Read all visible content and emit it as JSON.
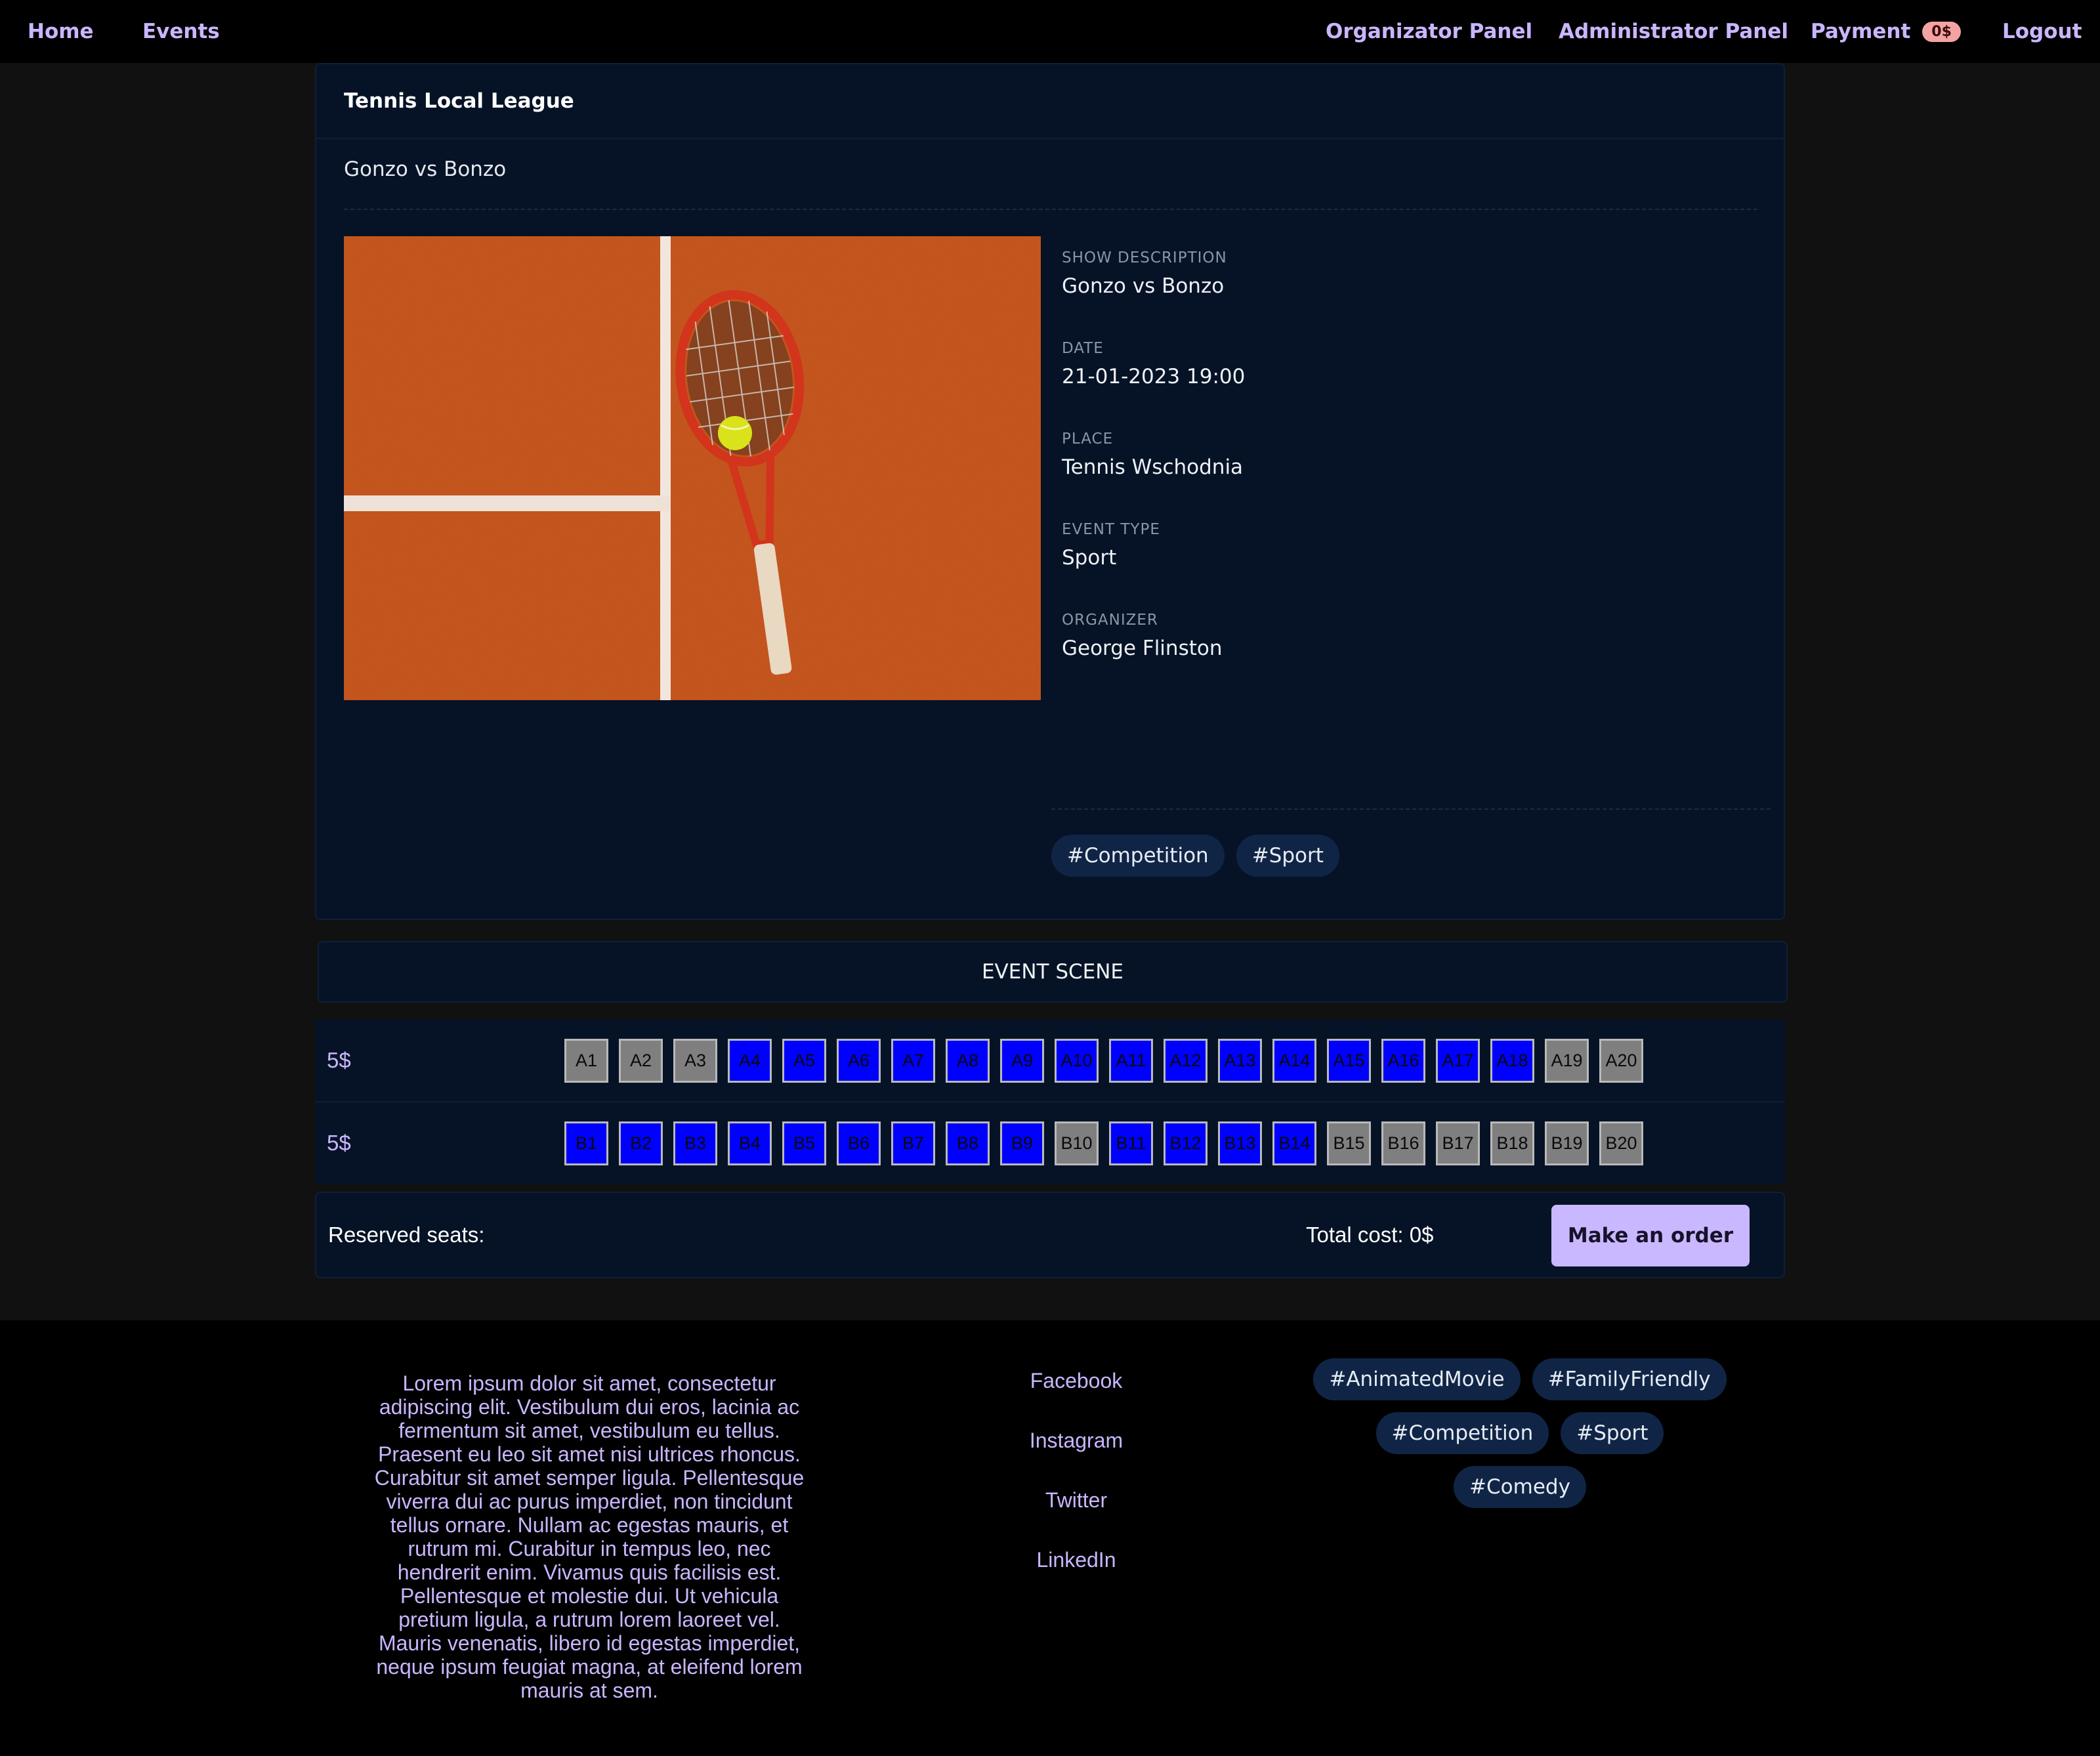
{
  "nav": {
    "home": "Home",
    "events": "Events",
    "organizer": "Organizator Panel",
    "admin": "Administrator Panel",
    "payment": "Payment",
    "payment_badge": "0$",
    "logout": "Logout"
  },
  "event": {
    "league": "Tennis Local League",
    "subtitle": "Gonzo vs Bonzo",
    "details": [
      {
        "label": "SHOW DESCRIPTION",
        "value": "Gonzo vs Bonzo"
      },
      {
        "label": "DATE",
        "value": "21-01-2023 19:00"
      },
      {
        "label": "PLACE",
        "value": "Tennis Wschodnia"
      },
      {
        "label": "EVENT TYPE",
        "value": "Sport"
      },
      {
        "label": "ORGANIZER",
        "value": "George Flinston"
      }
    ],
    "tags": [
      "#Competition",
      "#Sport"
    ]
  },
  "scene": {
    "title": "EVENT SCENE",
    "rows": [
      {
        "price": "5$",
        "seats": [
          {
            "label": "A1",
            "status": "free"
          },
          {
            "label": "A2",
            "status": "free"
          },
          {
            "label": "A3",
            "status": "free"
          },
          {
            "label": "A4",
            "status": "taken"
          },
          {
            "label": "A5",
            "status": "taken"
          },
          {
            "label": "A6",
            "status": "taken"
          },
          {
            "label": "A7",
            "status": "taken"
          },
          {
            "label": "A8",
            "status": "taken"
          },
          {
            "label": "A9",
            "status": "taken"
          },
          {
            "label": "A10",
            "status": "taken"
          },
          {
            "label": "A11",
            "status": "taken"
          },
          {
            "label": "A12",
            "status": "taken"
          },
          {
            "label": "A13",
            "status": "taken"
          },
          {
            "label": "A14",
            "status": "taken"
          },
          {
            "label": "A15",
            "status": "taken"
          },
          {
            "label": "A16",
            "status": "taken"
          },
          {
            "label": "A17",
            "status": "taken"
          },
          {
            "label": "A18",
            "status": "taken"
          },
          {
            "label": "A19",
            "status": "free"
          },
          {
            "label": "A20",
            "status": "free"
          }
        ]
      },
      {
        "price": "5$",
        "seats": [
          {
            "label": "B1",
            "status": "taken"
          },
          {
            "label": "B2",
            "status": "taken"
          },
          {
            "label": "B3",
            "status": "taken"
          },
          {
            "label": "B4",
            "status": "taken"
          },
          {
            "label": "B5",
            "status": "taken"
          },
          {
            "label": "B6",
            "status": "taken"
          },
          {
            "label": "B7",
            "status": "taken"
          },
          {
            "label": "B8",
            "status": "taken"
          },
          {
            "label": "B9",
            "status": "taken"
          },
          {
            "label": "B10",
            "status": "free"
          },
          {
            "label": "B11",
            "status": "taken"
          },
          {
            "label": "B12",
            "status": "taken"
          },
          {
            "label": "B13",
            "status": "taken"
          },
          {
            "label": "B14",
            "status": "taken"
          },
          {
            "label": "B15",
            "status": "free"
          },
          {
            "label": "B16",
            "status": "free"
          },
          {
            "label": "B17",
            "status": "free"
          },
          {
            "label": "B18",
            "status": "free"
          },
          {
            "label": "B19",
            "status": "free"
          },
          {
            "label": "B20",
            "status": "free"
          }
        ]
      }
    ]
  },
  "order": {
    "reserved_label": "Reserved seats:",
    "total_cost": "Total cost: 0$",
    "button": "Make an order"
  },
  "footer": {
    "text": "Lorem ipsum dolor sit amet, consectetur adipiscing elit. Vestibulum dui eros, lacinia ac fermentum sit amet, vestibulum eu tellus. Praesent eu leo sit amet nisi ultrices rhoncus. Curabitur sit amet semper ligula. Pellentesque viverra dui ac purus imperdiet, non tincidunt tellus ornare. Nullam ac egestas mauris, et rutrum mi. Curabitur in tempus leo, nec hendrerit enim. Vivamus quis facilisis est. Pellentesque et molestie dui. Ut vehicula pretium ligula, a rutrum lorem laoreet vel. Mauris venenatis, libero id egestas imperdiet, neque ipsum feugiat magna, at eleifend lorem mauris at sem.",
    "links": [
      "Facebook",
      "Instagram",
      "Twitter",
      "LinkedIn"
    ],
    "tags": [
      "#AnimatedMovie",
      "#FamilyFriendly",
      "#Competition",
      "#Sport",
      "#Comedy"
    ]
  },
  "colors": {
    "accent": "#c9b6ff",
    "seat_taken": "#0000ff",
    "seat_free": "#7f7f7f",
    "card_bg": "#061326",
    "tag_bg": "#102546"
  }
}
